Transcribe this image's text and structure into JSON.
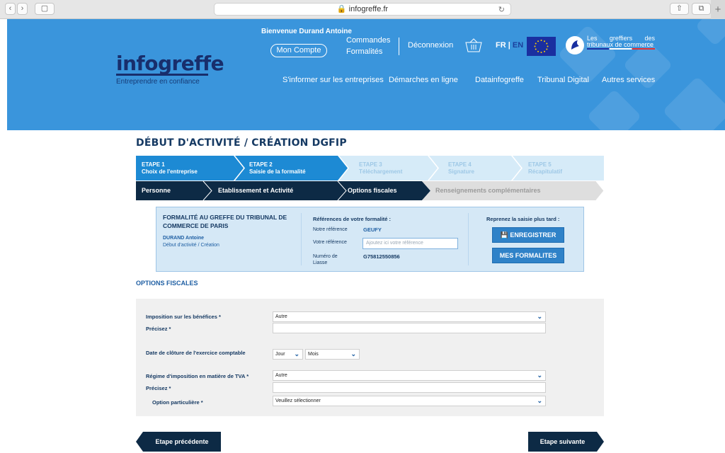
{
  "browser": {
    "url": "infogreffe.fr"
  },
  "header": {
    "logo_text": "infogreffe",
    "logo_tagline": "Entreprendre en confiance",
    "welcome": "Bienvenue Durand Antoine",
    "mon_compte": "Mon Compte",
    "commandes_line1": "Commandes",
    "commandes_line2": "Formalités",
    "deconnexion": "Déconnexion",
    "lang_fr": "FR",
    "lang_sep": "|",
    "lang_en": "EN",
    "greffiers_line1": "Les greffiers des",
    "greffiers_line2": "tribunaux de commerce",
    "nav": [
      "S'informer sur les entreprises",
      "Démarches en ligne",
      "Datainfogreffe",
      "Tribunal Digital",
      "Autres services"
    ]
  },
  "page_title": "DÉBUT D'ACTIVITÉ / CRÉATION DGFIP",
  "steps": [
    {
      "num": "ETAPE 1",
      "label": "Choix de l'entreprise"
    },
    {
      "num": "ETAPE 2",
      "label": "Saisie de la formalité"
    },
    {
      "num": "ETAPE 3",
      "label": "Téléchargement"
    },
    {
      "num": "ETAPE 4",
      "label": "Signature"
    },
    {
      "num": "ETAPE 5",
      "label": "Récapitulatif"
    }
  ],
  "substeps": [
    "Personne",
    "Etablissement et Activité",
    "Options fiscales",
    "Renseignements complémentaires"
  ],
  "infobox": {
    "greffe": "FORMALITÉ AU GREFFE DU TRIBUNAL DE COMMERCE DE PARIS",
    "name": "DURAND Antoine",
    "type": "Début d'activité / Création",
    "refs_title": "Références de votre formalité :",
    "notre_ref_label": "Notre référence",
    "notre_ref_value": "GEUFY",
    "votre_ref_label": "Votre référence",
    "votre_ref_placeholder": "Ajoutez ici votre référence",
    "liasse_label_1": "Numéro de",
    "liasse_label_2": "Liasse",
    "liasse_value": "G75812550856",
    "reprenez": "Reprenez la saisie plus tard :",
    "enregistrer": "ENREGISTRER",
    "mes_formalites": "MES FORMALITES"
  },
  "section_title": "OPTIONS FISCALES",
  "form": {
    "imposition_label": "Imposition sur les bénéfices *",
    "imposition_value": "Autre",
    "precisez1_label": "Précisez *",
    "cloture_label": "Date de clôture de l'exercice comptable",
    "jour_value": "Jour",
    "mois_value": "Mois",
    "tva_label": "Régime d'imposition en matière de TVA *",
    "tva_value": "Autre",
    "precisez2_label": "Précisez *",
    "option_label": "Option particulière *",
    "option_value": "Veuillez sélectionner"
  },
  "footer_nav": {
    "prev": "Etape précédente",
    "next": "Etape suivante"
  },
  "colors": {
    "header_blue": "#3a95dc",
    "step_active": "#1d8ad4",
    "step_inactive": "#d6ebf8",
    "substep_dark": "#0d2a45",
    "substep_inactive": "#dedede"
  }
}
